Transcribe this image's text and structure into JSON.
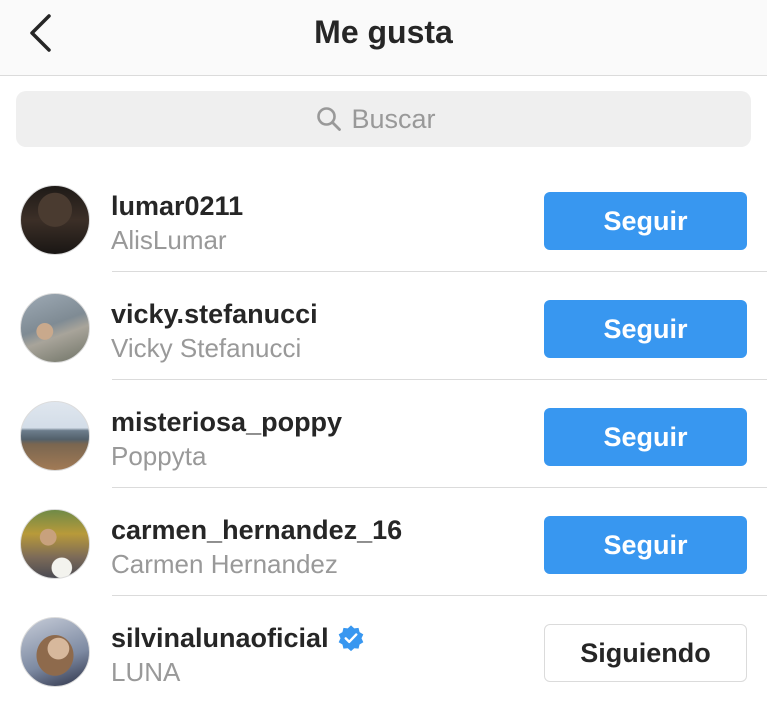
{
  "header": {
    "title": "Me gusta",
    "back_icon": "chevron-left-icon"
  },
  "search": {
    "placeholder": "Buscar",
    "icon": "search-icon"
  },
  "colors": {
    "accent": "#3897f0",
    "verified": "#3897f0",
    "secondary_text": "#999999",
    "separator": "#dbdbdb"
  },
  "users": [
    {
      "username": "lumar0211",
      "fullname": "AlisLumar",
      "action": "Seguir",
      "following": false,
      "verified": false
    },
    {
      "username": "vicky.stefanucci",
      "fullname": "Vicky Stefanucci",
      "action": "Seguir",
      "following": false,
      "verified": false
    },
    {
      "username": "misteriosa_poppy",
      "fullname": "Poppyta",
      "action": "Seguir",
      "following": false,
      "verified": false
    },
    {
      "username": "carmen_hernandez_16",
      "fullname": "Carmen Hernandez",
      "action": "Seguir",
      "following": false,
      "verified": false
    },
    {
      "username": "silvinalunaoficial",
      "fullname": "LUNA",
      "action": "Siguiendo",
      "following": true,
      "verified": true
    }
  ]
}
